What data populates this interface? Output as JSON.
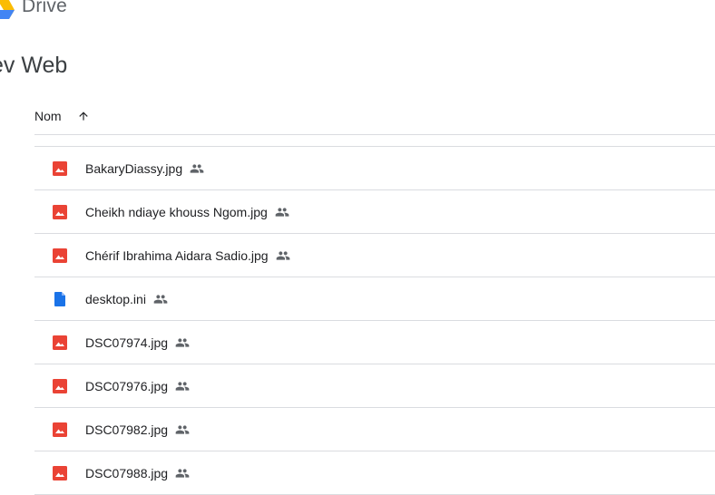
{
  "app": {
    "name": "Drive",
    "brand_colors": {
      "green": "#1e8e3e",
      "blue": "#4285f4",
      "yellow": "#fbbc04",
      "red": "#ea4335"
    }
  },
  "folder": {
    "title": "ev Web"
  },
  "list": {
    "header": {
      "name_label": "Nom",
      "sort_icon": "arrow-up-icon"
    },
    "files": [
      {
        "name": "BakaryDiassy.jpg",
        "type": "image",
        "shared": true
      },
      {
        "name": "Cheikh ndiaye khouss Ngom.jpg",
        "type": "image",
        "shared": true
      },
      {
        "name": "Chérif Ibrahima Aidara Sadio.jpg",
        "type": "image",
        "shared": true
      },
      {
        "name": "desktop.ini",
        "type": "document",
        "shared": true
      },
      {
        "name": "DSC07974.jpg",
        "type": "image",
        "shared": true
      },
      {
        "name": "DSC07976.jpg",
        "type": "image",
        "shared": true
      },
      {
        "name": "DSC07982.jpg",
        "type": "image",
        "shared": true
      },
      {
        "name": "DSC07988.jpg",
        "type": "image",
        "shared": true
      }
    ]
  },
  "icon_colors": {
    "image": "#ea4335",
    "document": "#1a73e8",
    "shared": "#5f6368"
  }
}
